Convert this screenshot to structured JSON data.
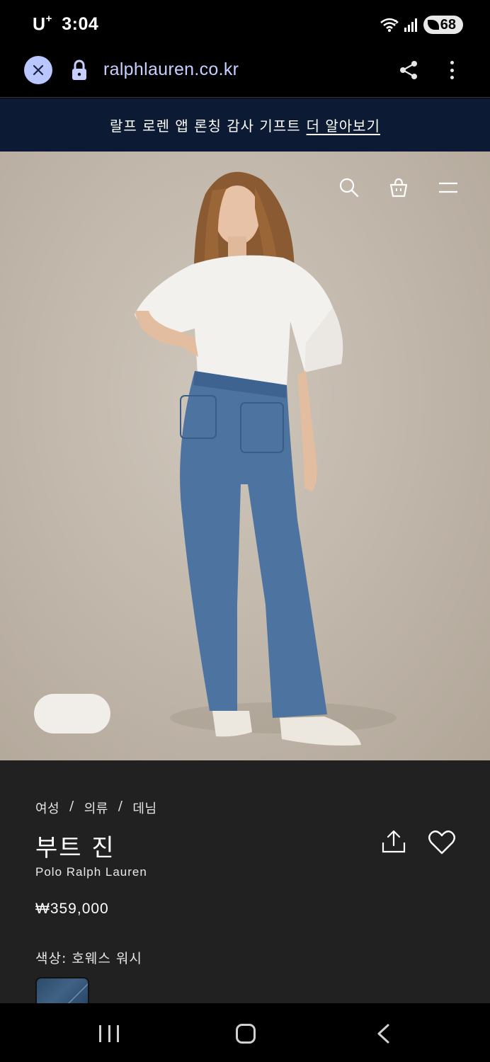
{
  "status_bar": {
    "carrier": "U",
    "carrier_sup": "+",
    "time": "3:04",
    "battery": "68"
  },
  "browser": {
    "url": "ralphlauren.co.kr",
    "icons": [
      "close-icon",
      "lock-icon",
      "share-icon",
      "more-vertical-icon"
    ]
  },
  "promo": {
    "text": "랄프 로렌 앱 론칭 감사 기프트",
    "link": "더 알아보기"
  },
  "hero": {
    "icons": [
      "search-icon",
      "shopping-bag-icon",
      "menu-icon"
    ]
  },
  "product": {
    "breadcrumb": [
      "여성",
      "/",
      "의류",
      "/",
      "데님"
    ],
    "title": "부트 진",
    "brand": "Polo Ralph Lauren",
    "price": "₩359,000",
    "color_label": "색상: 호웨스 워시"
  },
  "colors": {
    "promo_bg": "#0c1a33",
    "info_bg": "#212121",
    "url_text": "#c6cfff",
    "close_circle": "#b9c6ff"
  }
}
